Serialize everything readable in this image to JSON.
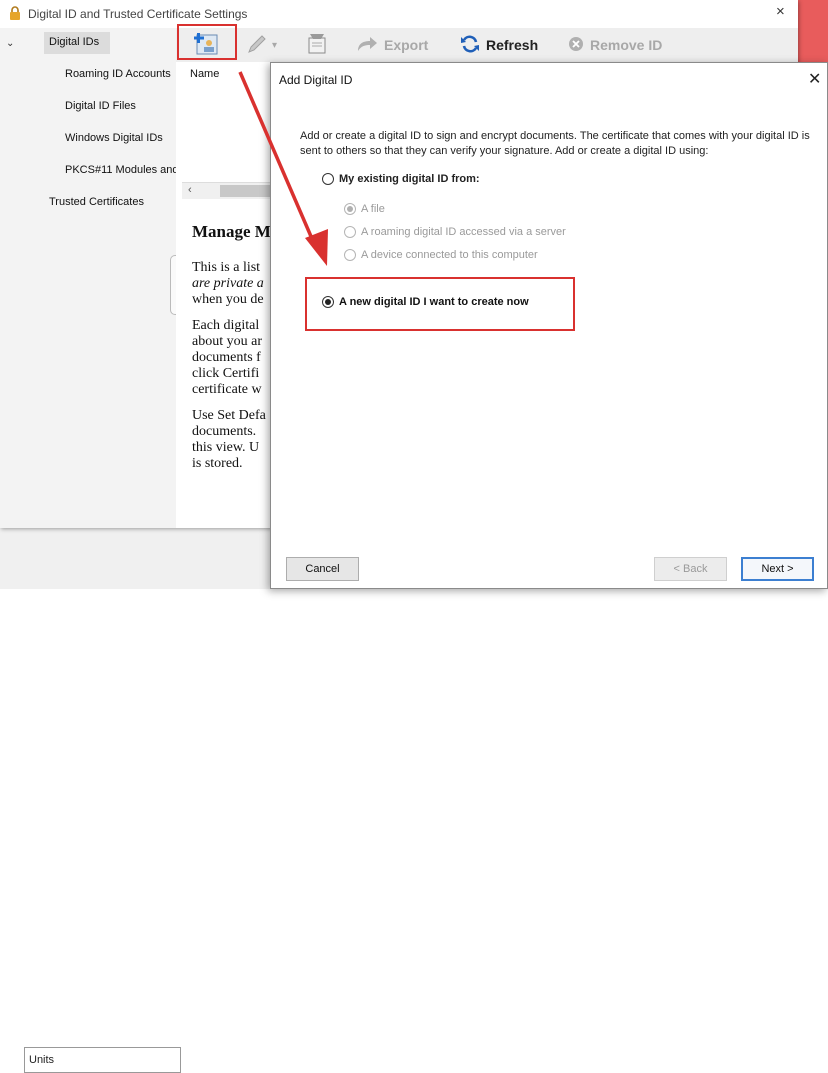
{
  "main_window": {
    "title": "Digital ID and Trusted Certificate Settings",
    "close_glyph": "×"
  },
  "sidebar": {
    "expand_glyph": "⌄",
    "items": [
      {
        "label": "Digital IDs",
        "selected": true
      },
      {
        "label": "Roaming ID Accounts"
      },
      {
        "label": "Digital ID Files"
      },
      {
        "label": "Windows Digital IDs"
      },
      {
        "label": "PKCS#11 Modules and"
      },
      {
        "label": "Trusted Certificates"
      }
    ]
  },
  "toolbar": {
    "export_label": "Export",
    "refresh_label": "Refresh",
    "remove_label": "Remove ID",
    "dropdown_glyph": "▾"
  },
  "content": {
    "column_name": "Name",
    "scroll_left_glyph": "‹",
    "help_heading": "Manage M",
    "help_paragraphs": [
      [
        "This is a list",
        "are private a",
        "when you de"
      ],
      [
        "Each digital",
        "about you ar",
        "documents f",
        "click Certifi",
        "certificate w"
      ],
      [
        "Use Set Defa",
        "documents.",
        "this view. U",
        "is stored."
      ]
    ]
  },
  "background": {
    "units_label": "Units"
  },
  "dialog": {
    "title": "Add Digital ID",
    "close_glyph": "✕",
    "description": "Add or create a digital ID to sign and encrypt documents. The certificate that comes with your digital ID is sent to others so that they can verify your signature. Add or create a digital ID using:",
    "option_existing": "My existing digital ID from:",
    "sub_file": "A file",
    "sub_roaming": "A roaming digital ID accessed via a server",
    "sub_device": "A device connected to this computer",
    "option_new": "A new digital ID I want to create now",
    "cancel_label": "Cancel",
    "back_label": "< Back",
    "next_label": "Next >"
  },
  "colors": {
    "annotation_red": "#d9312f",
    "accent_blue": "#3c7fd1"
  }
}
